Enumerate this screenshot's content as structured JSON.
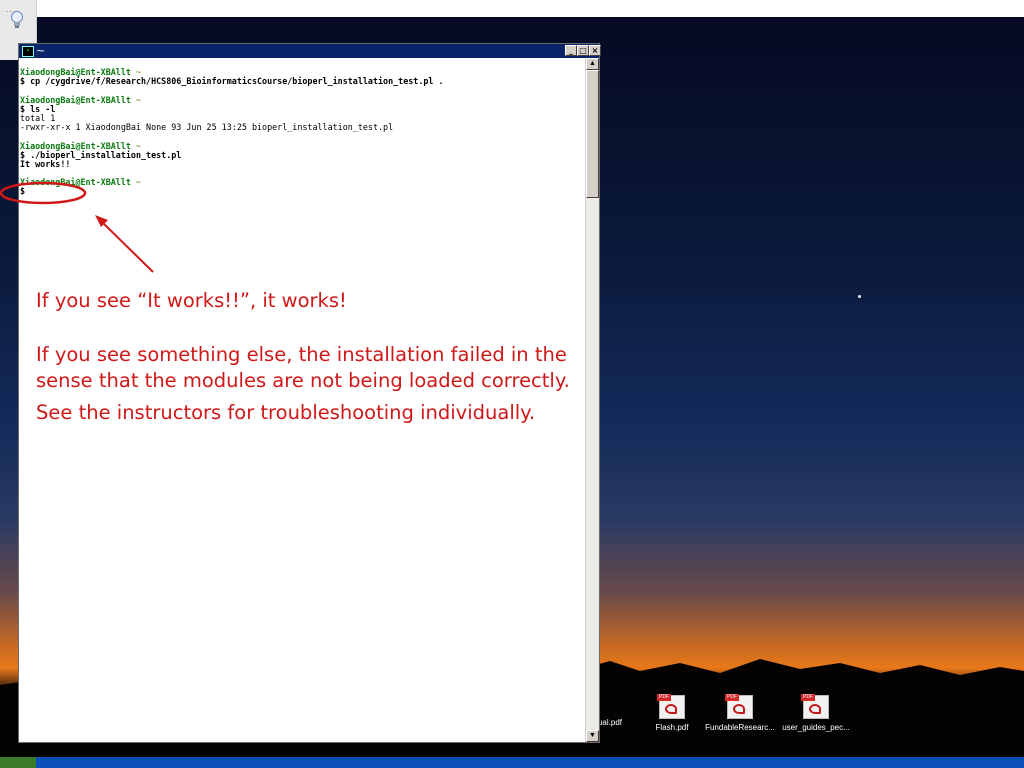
{
  "window": {
    "title": "~",
    "buttons": {
      "minimize": "_",
      "maximize": "□",
      "close": "×"
    }
  },
  "terminal": {
    "lines": [
      {
        "kind": "prompt",
        "user": "XiaodongBai@Ent-XBAllt",
        "cwd": "~"
      },
      {
        "kind": "command",
        "text": "$ cp /cygdrive/f/Research/HCS806_BioinformaticsCourse/bioperl_installation_test.pl ."
      },
      {
        "kind": "blank"
      },
      {
        "kind": "prompt",
        "user": "XiaodongBai@Ent-XBAllt",
        "cwd": "~"
      },
      {
        "kind": "command",
        "text": "$ ls -l"
      },
      {
        "kind": "output",
        "text": "total 1"
      },
      {
        "kind": "output",
        "text": "-rwxr-xr-x 1 XiaodongBai None 93 Jun 25 13:25 bioperl_installation_test.pl"
      },
      {
        "kind": "blank"
      },
      {
        "kind": "prompt",
        "user": "XiaodongBai@Ent-XBAllt",
        "cwd": "~"
      },
      {
        "kind": "command",
        "text": "$ ./bioperl_installation_test.pl"
      },
      {
        "kind": "output",
        "text": "It works!!"
      },
      {
        "kind": "blank"
      },
      {
        "kind": "prompt",
        "user": "XiaodongBai@Ent-XBAllt",
        "cwd": "~"
      },
      {
        "kind": "command",
        "text": "$"
      }
    ]
  },
  "annotations": {
    "line1": "If you see “It works!!”, it works!",
    "line2": "If you see something else, the installation failed in the",
    "line3": "sense that the modules are not being loaded correctly.",
    "line4": "See the instructors for troubleshooting individually.",
    "color": "#d01818"
  },
  "desktop": {
    "icons": [
      {
        "label": "ual.pdf"
      },
      {
        "label": "Flash.pdf"
      },
      {
        "label": "FundableResearc..."
      },
      {
        "label": "user_guides_pec..."
      }
    ],
    "quicklaunch_dots": "....",
    "pdf_badge": "PDF"
  },
  "colors": {
    "titlebar": "#0a246a",
    "prompt": "#0b7a10",
    "taskbar": "#0a50b8"
  }
}
